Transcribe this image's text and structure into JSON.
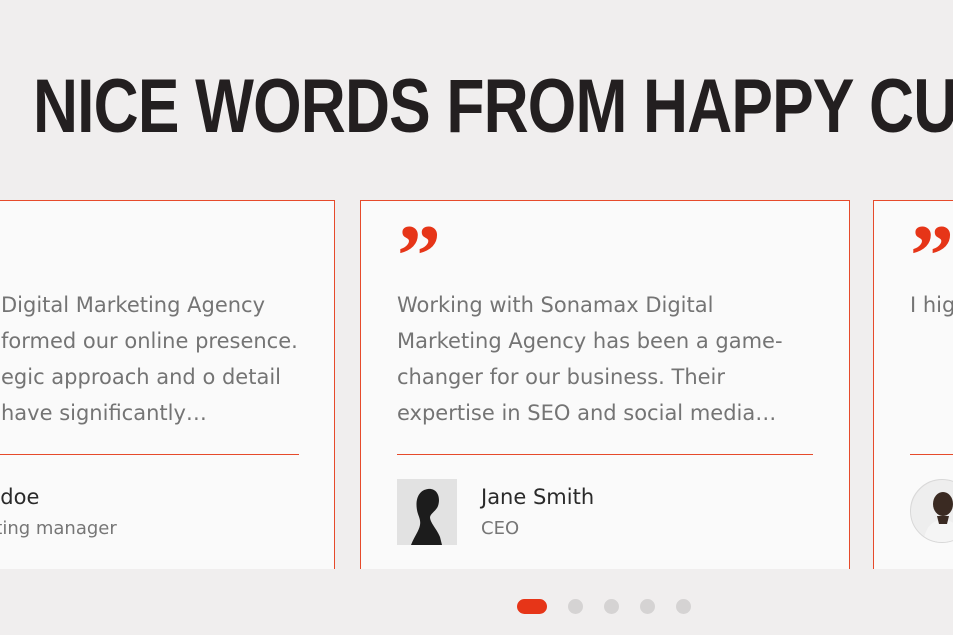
{
  "heading": "NICE WORDS FROM HAPPY CUSTOMERS",
  "testimonials": [
    {
      "quote": "Digital Marketing Agency formed our online presence. egic approach and o detail have significantly…",
      "name": "nn doe",
      "role": "rketing manager"
    },
    {
      "quote_icon": "quote-icon",
      "quote": "Working with Sonamax Digital Marketing Agency has been a game-changer for our business. Their expertise in SEO and social media…",
      "name": "Jane Smith",
      "role": "CEO",
      "avatar": "woman-silhouette-avatar"
    },
    {
      "quote_icon": "quote-icon",
      "quote": "I hig Mar to in The",
      "avatar": "man-avatar"
    }
  ],
  "pagination": {
    "count": 5,
    "active_index": 0
  },
  "colors": {
    "accent": "#e63518",
    "heading": "#231f20",
    "text": "#747474",
    "background": "#f0eeee",
    "card": "#fafafa"
  }
}
